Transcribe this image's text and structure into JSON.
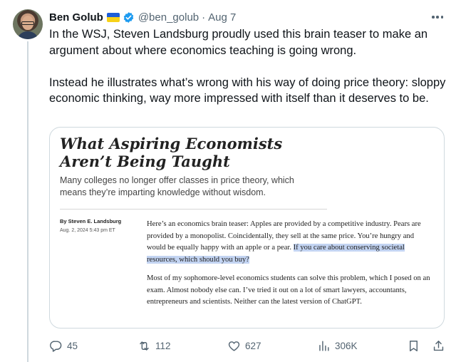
{
  "tweet": {
    "author_name": "Ben Golub",
    "handle": "@ben_golub",
    "separator": "·",
    "date": "Aug 7",
    "text_p1": "In the WSJ, Steven Landsburg proudly used this brain teaser to make an argument about where economics teaching is going wrong.",
    "text_p2": "Instead he illustrates what’s wrong with his way of doing price theory: sloppy economic thinking, way more impressed with itself than it deserves to be."
  },
  "article": {
    "headline": "What Aspiring Economists Aren’t Being Taught",
    "subhead": "Many colleges no longer offer classes in price theory, which means they’re imparting knowledge without wisdom.",
    "byline": "By Steven E. Landsburg",
    "dateline": "Aug. 2, 2024 5:43 pm ET",
    "para1_plain": "Here’s an economics brain teaser: Apples are provided by a competitive industry. Pears are provided by a monopolist. Coincidentally, they sell at the same price. You’re hungry and would be equally happy with an apple or a pear. ",
    "para1_highlight": "If you care about conserving societal resources, which should you buy?",
    "para2": "Most of my sophomore-level economics students can solve this problem, which I posed on an exam. Almost nobody else can. I’ve tried it out on a lot of smart lawyers, accountants, entrepreneurs and scientists. Neither can the latest version of ChatGPT."
  },
  "actions": {
    "replies": "45",
    "reposts": "112",
    "likes": "627",
    "views": "306K"
  },
  "icons": {
    "verified": "verified-badge-icon",
    "flag": "ukraine-flag-icon",
    "more": "more-icon",
    "reply": "reply-icon",
    "repost": "repost-icon",
    "like": "heart-icon",
    "views": "views-icon",
    "bookmark": "bookmark-icon",
    "share": "share-icon"
  },
  "colors": {
    "verified_blue": "#1d9bf0",
    "muted_text": "#536471",
    "highlight": "#c3d4f2"
  }
}
